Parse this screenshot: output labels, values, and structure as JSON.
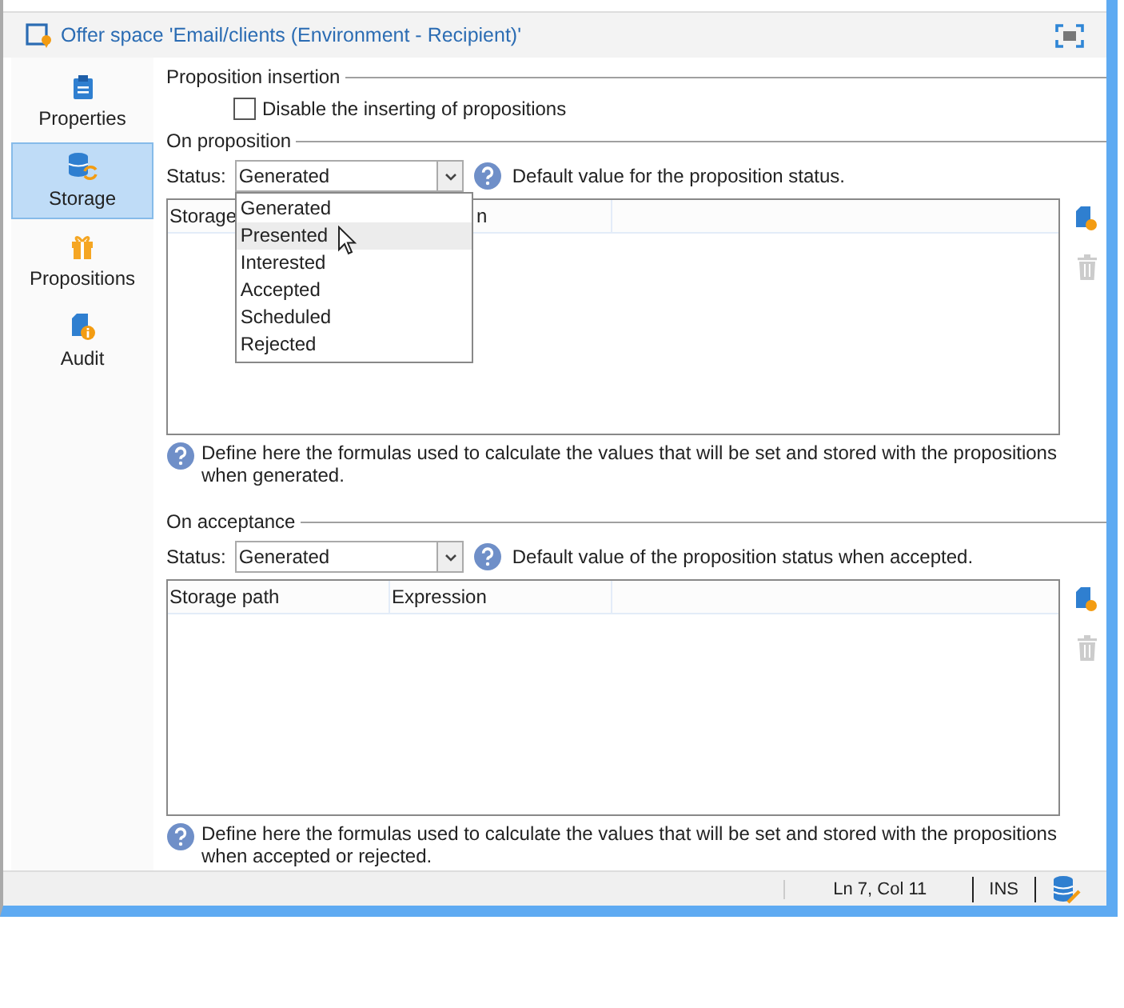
{
  "header": {
    "title": "Offer space 'Email/clients (Environment - Recipient)'"
  },
  "sidebar": {
    "items": [
      {
        "label": "Properties",
        "kind": "properties",
        "selected": false
      },
      {
        "label": "Storage",
        "kind": "storage",
        "selected": true
      },
      {
        "label": "Propositions",
        "kind": "propositions",
        "selected": false
      },
      {
        "label": "Audit",
        "kind": "audit",
        "selected": false
      }
    ]
  },
  "insertion": {
    "heading": "Proposition insertion",
    "checkbox": {
      "label": "Disable the inserting of propositions",
      "checked": false
    }
  },
  "sections": [
    {
      "heading": "On proposition",
      "status_label": "Status:",
      "status_value": "Generated",
      "status_help": "Default value for the proposition status.",
      "columns": [
        "Storage",
        "n"
      ],
      "help": "Define here the formulas used to calculate the values that will be set and stored with the propositions when generated."
    },
    {
      "heading": "On acceptance",
      "status_label": "Status:",
      "status_value": "Generated",
      "status_help": "Default value of the proposition status when accepted.",
      "columns": [
        "Storage path",
        "Expression"
      ],
      "help": "Define here the formulas used to calculate the values that will be set and stored with the propositions when accepted or rejected."
    }
  ],
  "dropdown": {
    "options": [
      {
        "label": "Generated",
        "selected": false
      },
      {
        "label": "Presented",
        "selected": true
      },
      {
        "label": "Interested",
        "selected": false
      },
      {
        "label": "Accepted",
        "selected": false
      },
      {
        "label": "Scheduled",
        "selected": false
      },
      {
        "label": "Rejected",
        "selected": false
      }
    ]
  },
  "status_bar": {
    "position": "Ln 7, Col 11",
    "mode": "INS"
  }
}
